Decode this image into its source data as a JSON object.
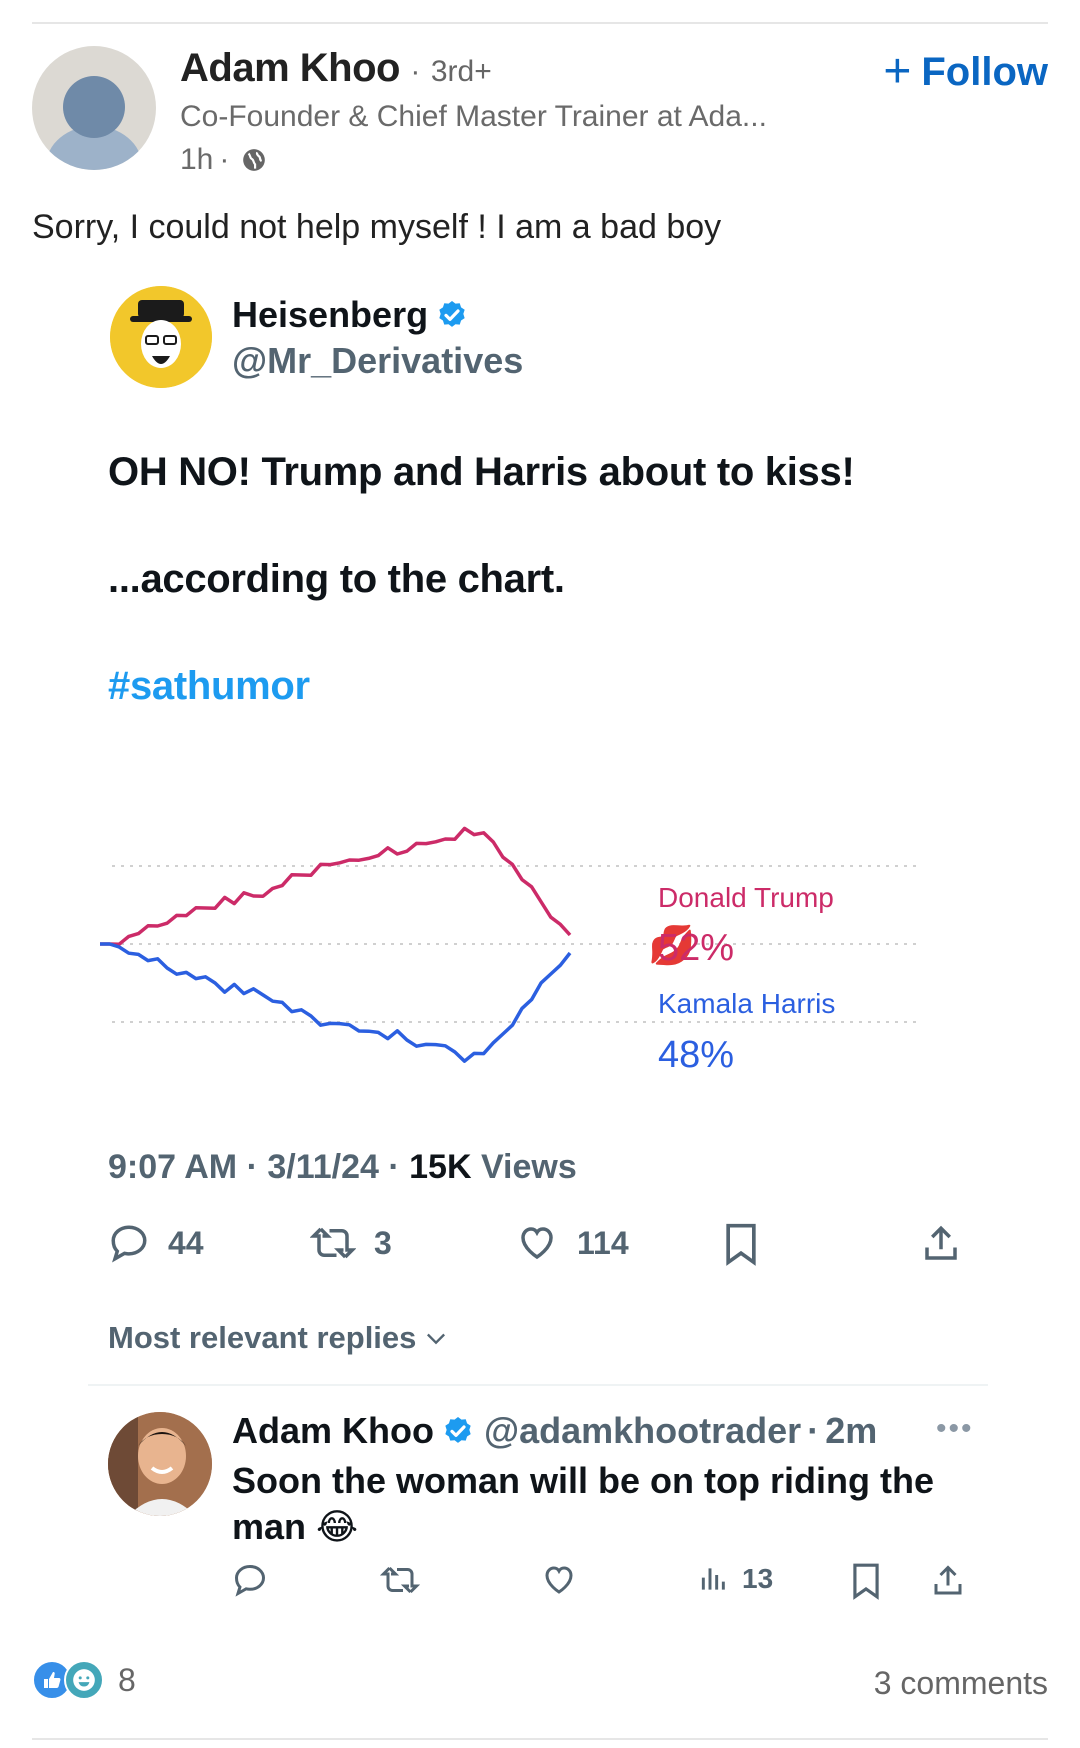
{
  "post": {
    "author_name": "Adam Khoo",
    "degree": "3rd+",
    "headline": "Co-Founder & Chief Master Trainer at Ada...",
    "time": "1h",
    "follow_label": "Follow",
    "text": "Sorry, I could not help myself ! I am a bad boy"
  },
  "tweet": {
    "name": "Heisenberg",
    "handle": "@Mr_Derivatives",
    "line1": "OH NO! Trump and Harris about to kiss!",
    "line2": "...according to the chart.",
    "hashtag": "#sathumor",
    "time": "9:07 AM",
    "date": "3/11/24",
    "views_count": "15K",
    "views_label": "Views",
    "replies": "44",
    "retweets": "3",
    "likes": "114",
    "most_relevant": "Most relevant replies"
  },
  "chart_data": {
    "type": "line",
    "title": "",
    "series": [
      {
        "name": "Donald Trump",
        "end_label": "52%",
        "color": "#cc2b68",
        "values": [
          0,
          0,
          1,
          2,
          4,
          5,
          6,
          8,
          9,
          10,
          11,
          12,
          13,
          15,
          14,
          16,
          16,
          17,
          18,
          20,
          22,
          23,
          24,
          26,
          27,
          26,
          28,
          29,
          28,
          30,
          31,
          30,
          32,
          33,
          34,
          33,
          35,
          36,
          38,
          37,
          36,
          34,
          30,
          26,
          22,
          18,
          14,
          10,
          6,
          3
        ]
      },
      {
        "name": "Kamala Harris",
        "end_label": "48%",
        "color": "#2b5fe0",
        "values": [
          0,
          0,
          -1,
          -2,
          -4,
          -5,
          -6,
          -8,
          -9,
          -10,
          -11,
          -12,
          -13,
          -15,
          -14,
          -16,
          -16,
          -17,
          -18,
          -20,
          -22,
          -23,
          -24,
          -26,
          -27,
          -26,
          -28,
          -29,
          -28,
          -30,
          -31,
          -30,
          -32,
          -33,
          -34,
          -33,
          -35,
          -36,
          -38,
          -37,
          -36,
          -34,
          -30,
          -26,
          -22,
          -18,
          -14,
          -10,
          -6,
          -3
        ]
      }
    ],
    "grid": true,
    "legend": "right"
  },
  "reply": {
    "name": "Adam Khoo",
    "handle": "@adamkhootrader",
    "time": "2m",
    "text": "Soon the woman will be on top  riding the man",
    "emoji": "😂",
    "views": "13"
  },
  "footer": {
    "reaction_count": "8",
    "comments": "3 comments"
  },
  "colors": {
    "linkedin_blue": "#0a66c2",
    "twitter_blue": "#1d9bf0",
    "trump_red": "#cc2b68",
    "harris_blue": "#2b5fe0"
  }
}
